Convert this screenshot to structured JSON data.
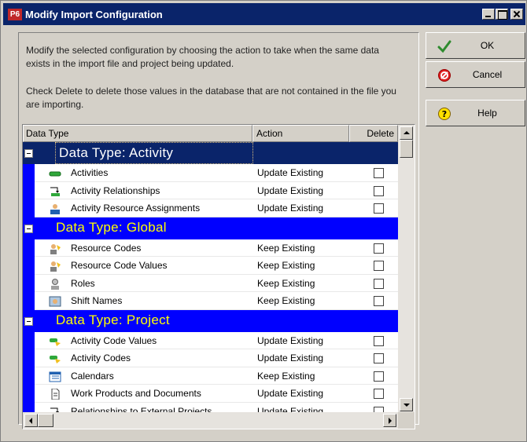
{
  "window": {
    "app_icon_text": "P6",
    "title": "Modify Import Configuration"
  },
  "description": {
    "line1": "Modify the selected configuration by choosing the action to take when the same data exists in the import file and project being updated.",
    "line2": "Check Delete to delete those values in the database that are not contained in the file you are importing."
  },
  "grid": {
    "headers": {
      "data_type": "Data Type",
      "action": "Action",
      "delete": "Delete"
    },
    "groups": [
      {
        "title": "Data Type: Activity",
        "items": [
          {
            "name": "Activities",
            "action": "Update Existing",
            "delete": false,
            "icon": "activity-icon"
          },
          {
            "name": "Activity Relationships",
            "action": "Update Existing",
            "delete": false,
            "icon": "relationship-icon"
          },
          {
            "name": "Activity Resource Assignments",
            "action": "Update Existing",
            "delete": false,
            "icon": "resource-assignment-icon"
          }
        ]
      },
      {
        "title": "Data Type: Global",
        "items": [
          {
            "name": "Resource Codes",
            "action": "Keep Existing",
            "delete": false,
            "icon": "resource-code-icon"
          },
          {
            "name": "Resource Code Values",
            "action": "Keep Existing",
            "delete": false,
            "icon": "resource-code-value-icon"
          },
          {
            "name": "Roles",
            "action": "Keep Existing",
            "delete": false,
            "icon": "role-icon"
          },
          {
            "name": "Shift Names",
            "action": "Keep Existing",
            "delete": false,
            "icon": "shift-icon"
          }
        ]
      },
      {
        "title": "Data Type: Project",
        "items": [
          {
            "name": "Activity Code Values",
            "action": "Update Existing",
            "delete": false,
            "icon": "activity-code-value-icon"
          },
          {
            "name": "Activity Codes",
            "action": "Update Existing",
            "delete": false,
            "icon": "activity-code-icon"
          },
          {
            "name": "Calendars",
            "action": "Keep Existing",
            "delete": false,
            "icon": "calendar-icon"
          },
          {
            "name": "Work Products and Documents",
            "action": "Update Existing",
            "delete": false,
            "icon": "document-icon"
          },
          {
            "name": "Relationships to External Projects",
            "action": "Update Existing",
            "delete": false,
            "icon": "external-relationship-icon"
          }
        ]
      }
    ]
  },
  "buttons": {
    "ok": "OK",
    "cancel": "Cancel",
    "help": "Help"
  },
  "colors": {
    "title_bar": "#0a246a",
    "group_band": "#0000ff",
    "group_text": "#ffff00"
  }
}
